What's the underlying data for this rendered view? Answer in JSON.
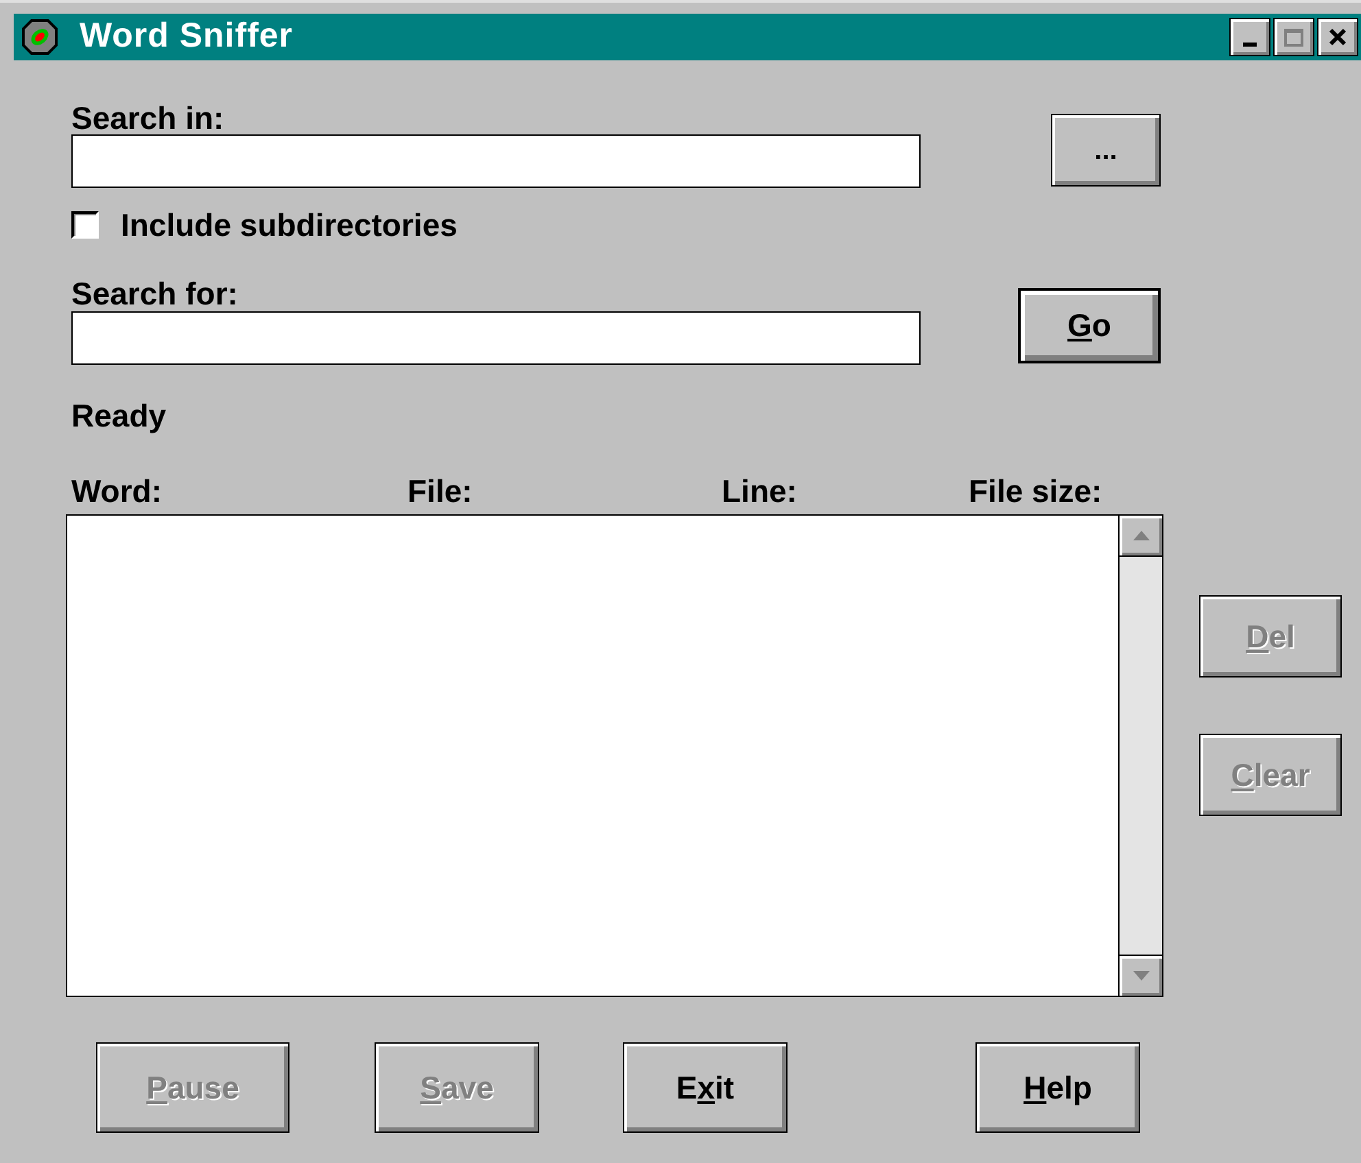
{
  "window": {
    "title": "Word Sniffer",
    "maximize_disabled": true
  },
  "search_in": {
    "label": "Search in:"
  },
  "browse_button": {
    "label": "..."
  },
  "include_subdirectories": {
    "label": "Include subdirectories",
    "checked": false
  },
  "search_for": {
    "label": "Search for:"
  },
  "go_button": {
    "label": [
      {
        "text": "G",
        "underlined": true
      },
      {
        "text": "o",
        "underlined": false
      }
    ],
    "default": true
  },
  "status": "Ready",
  "results": {
    "columns": [
      "Word:",
      "File:",
      "Line:",
      "File size:"
    ]
  },
  "side_buttons": [
    {
      "label": [
        {
          "text": "D",
          "underlined": true
        },
        {
          "text": "el",
          "underlined": false
        }
      ],
      "disabled": true
    },
    {
      "label": [
        {
          "text": "C",
          "underlined": true
        },
        {
          "text": "lear",
          "underlined": false
        }
      ],
      "disabled": true
    }
  ],
  "bottom_buttons": [
    {
      "label": [
        {
          "text": "P",
          "underlined": true
        },
        {
          "text": "ause",
          "underlined": false
        }
      ],
      "disabled": true
    },
    {
      "label": [
        {
          "text": "S",
          "underlined": true
        },
        {
          "text": "ave",
          "underlined": false
        }
      ],
      "disabled": true
    },
    {
      "label": [
        {
          "text": "E",
          "underlined": false
        },
        {
          "text": "x",
          "underlined": true
        },
        {
          "text": "it",
          "underlined": false
        }
      ],
      "disabled": false
    },
    {
      "label": [
        {
          "text": "H",
          "underlined": true
        },
        {
          "text": "elp",
          "underlined": false
        }
      ],
      "disabled": false
    }
  ]
}
